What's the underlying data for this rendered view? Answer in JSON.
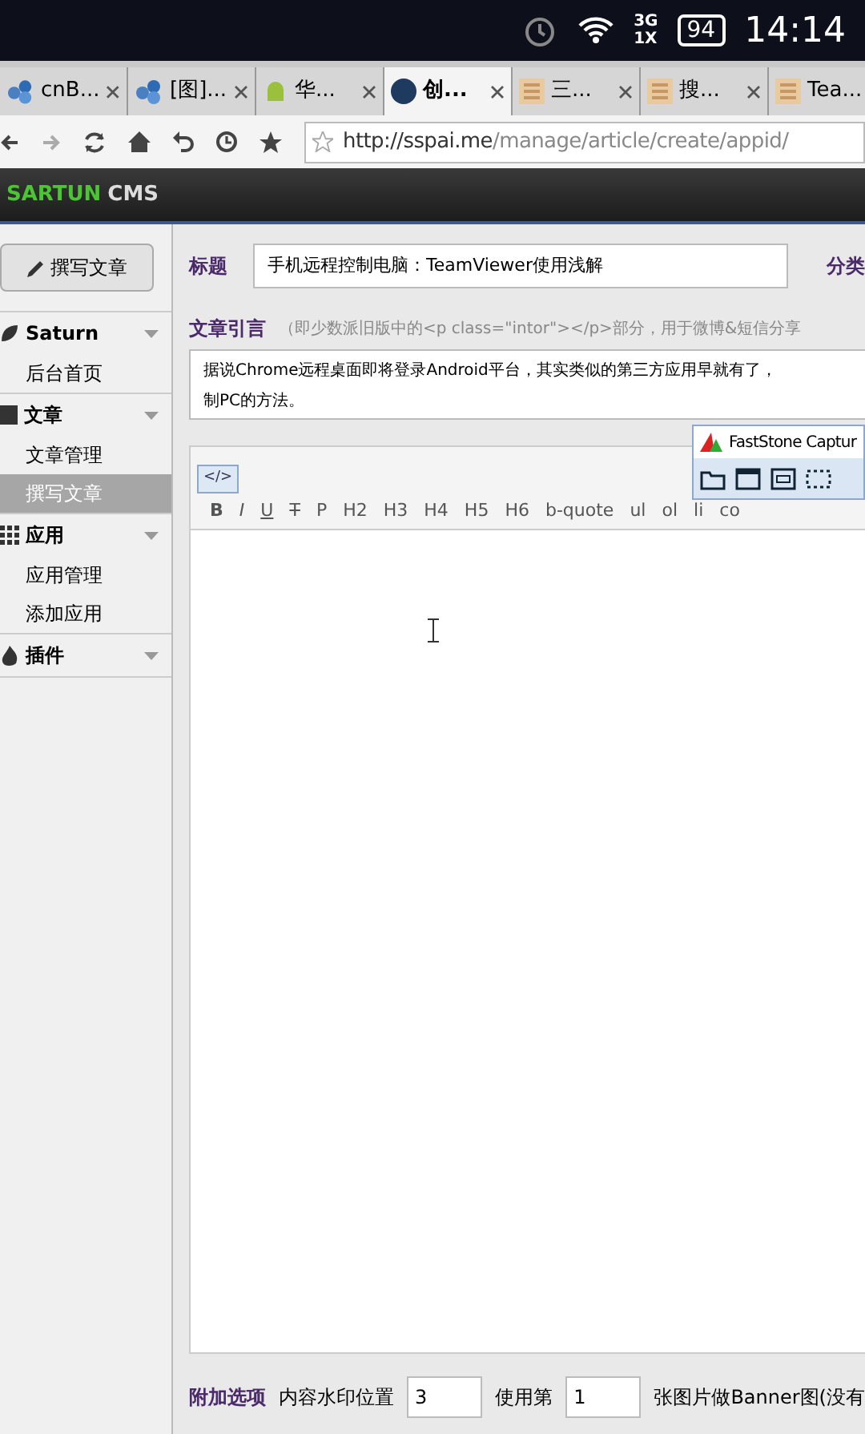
{
  "status_bar": {
    "network_top": "3G",
    "network_bottom": "1X",
    "battery": "94",
    "time": "14:14"
  },
  "tabs": [
    {
      "label": "cnB...",
      "selected": false,
      "kind": "hex"
    },
    {
      "label": "[图]...",
      "selected": false,
      "kind": "hex"
    },
    {
      "label": "华...",
      "selected": false,
      "kind": "android"
    },
    {
      "label": "创...",
      "selected": true,
      "kind": "pi"
    },
    {
      "label": "三...",
      "selected": false,
      "kind": "tile"
    },
    {
      "label": "搜...",
      "selected": false,
      "kind": "tile"
    },
    {
      "label": "Tea...",
      "selected": false,
      "kind": "tile"
    }
  ],
  "address": {
    "host": "http://sspai.me",
    "path": "/manage/article/create/appid/"
  },
  "brand": {
    "name": "SARTUN",
    "suffix": "CMS"
  },
  "sidebar": {
    "write_button": "撰写文章",
    "groups": [
      {
        "kind": "leaf",
        "title": "Saturn",
        "items": [
          {
            "label": "后台首页",
            "selected": false
          }
        ]
      },
      {
        "kind": "book",
        "title": "文章",
        "items": [
          {
            "label": "文章管理",
            "selected": false
          },
          {
            "label": "撰写文章",
            "selected": true
          }
        ]
      },
      {
        "kind": "grid",
        "title": "应用",
        "items": [
          {
            "label": "应用管理",
            "selected": false
          },
          {
            "label": "添加应用",
            "selected": false
          }
        ]
      },
      {
        "kind": "fire",
        "title": "插件"
      }
    ]
  },
  "form": {
    "title_label": "标题",
    "title_value": "手机远程控制电脑：TeamViewer使用浅解",
    "category_label": "分类",
    "intro_label": "文章引言",
    "intro_hint": "（即少数派旧版中的<p class=\"intor\"></p>部分，用于微博&短信分享",
    "intro_lines": [
      "据说Chrome远程桌面即将登录Android平台，其实类似的第三方应用早就有了，",
      "制PC的方法。"
    ],
    "code_button": "</>",
    "toolbar": [
      "B",
      "I",
      "U",
      "T",
      "P",
      "H2",
      "H3",
      "H4",
      "H5",
      "H6",
      "b-quote",
      "ul",
      "ol",
      "li",
      "co"
    ],
    "options_label": "附加选项",
    "watermark_label": "内容水印位置",
    "watermark_value": "3",
    "banner_label": "使用第",
    "banner_value": "1",
    "banner_suffix": "张图片做Banner图(没有"
  },
  "faststone": {
    "title": "FastStone Captur"
  }
}
